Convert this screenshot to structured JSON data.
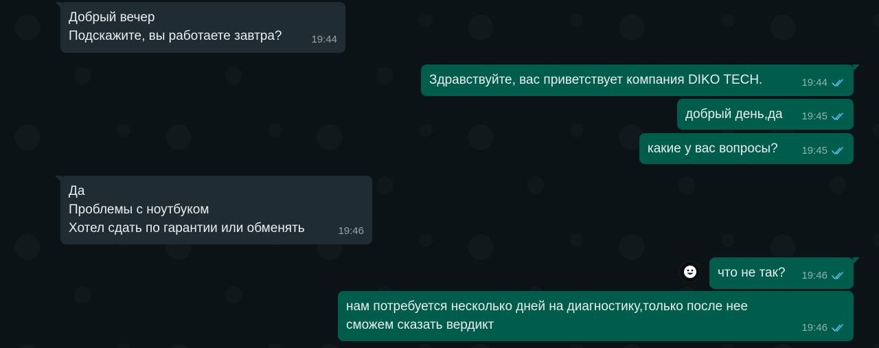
{
  "messages": [
    {
      "direction": "in",
      "lines": [
        "Добрый вечер",
        "Подскажите, вы работаете завтра?"
      ],
      "time": "19:44"
    },
    {
      "direction": "out",
      "lines": [
        "Здравствуйте, вас приветствует компания DIKO TECH."
      ],
      "time": "19:44",
      "status": "read"
    },
    {
      "direction": "out",
      "lines": [
        "добрый день,да"
      ],
      "time": "19:45",
      "status": "read"
    },
    {
      "direction": "out",
      "lines": [
        "какие у вас вопросы?"
      ],
      "time": "19:45",
      "status": "read"
    },
    {
      "direction": "in",
      "lines": [
        "Да",
        "Проблемы с ноутбуком",
        "Хотел сдать по гарантии или обменять"
      ],
      "time": "19:46"
    },
    {
      "direction": "out",
      "lines": [
        "что не так?"
      ],
      "time": "19:46",
      "status": "read"
    },
    {
      "direction": "out",
      "lines": [
        "нам потребуется несколько дней на диагностику,только после нее",
        "сможем сказать вердикт"
      ],
      "time": "19:46",
      "status": "read"
    }
  ],
  "colors": {
    "incoming_bubble": "#1f2c33",
    "outgoing_bubble": "#005c4b",
    "read_check": "#53bdeb",
    "background": "#0c1317"
  },
  "icons": {
    "reaction": "smiley-face-icon",
    "status": "double-check-icon"
  }
}
